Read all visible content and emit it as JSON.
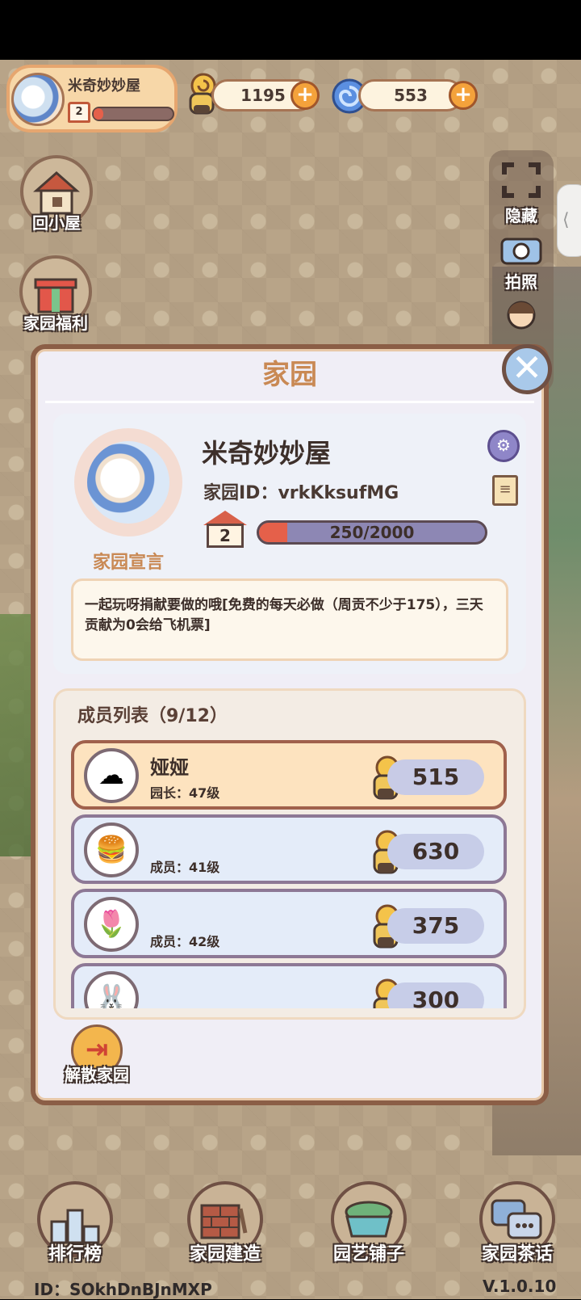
{
  "header": {
    "profile_name": "米奇妙妙屋",
    "profile_level": "2",
    "profile_xp_fraction": 0.125,
    "snail_coins": "1195",
    "swirl_gems": "553"
  },
  "side_menu": {
    "home_label": "回小屋",
    "welfare_label": "家园福利"
  },
  "right_tools": {
    "hide_label": "隐藏",
    "photo_label": "拍照"
  },
  "panel": {
    "title": "家园",
    "garden_name": "米奇妙妙屋",
    "garden_id": "家园ID：vrkKksufMG",
    "declaration_label": "家园宣言",
    "level": "2",
    "xp_text": "250/2000",
    "xp_fraction": 0.125,
    "announcement": "一起玩呀捐献要做的哦[免费的每天必做（周贡不少于175），三天贡献为0会给飞机票]",
    "members_title": "成员列表（9/12）",
    "members": [
      {
        "name": "娅娅",
        "role": "园长：47级",
        "score": "515",
        "avatar_icon": "cloud-face-icon",
        "leader": true
      },
      {
        "name": "",
        "role": "成员：41级",
        "score": "630",
        "avatar_icon": "burger-icon",
        "leader": false
      },
      {
        "name": "",
        "role": "成员：42级",
        "score": "375",
        "avatar_icon": "tulip-icon",
        "leader": false
      },
      {
        "name": "",
        "role": "",
        "score": "300",
        "avatar_icon": "bunny-icon",
        "leader": false
      }
    ],
    "disband_label": "解散家园"
  },
  "bottom_nav": {
    "ranking_label": "排行榜",
    "build_label": "家园建造",
    "garden_shop_label": "园艺铺子",
    "chat_label": "家园茶话"
  },
  "footer": {
    "user_id": "ID：SOkhDnBJnMXP",
    "version": "V.1.0.10"
  },
  "colors": {
    "accent_orange": "#f4a23b",
    "xp_red": "#e5604a",
    "panel_border": "#8b5e46",
    "title_tan": "#c98954"
  }
}
